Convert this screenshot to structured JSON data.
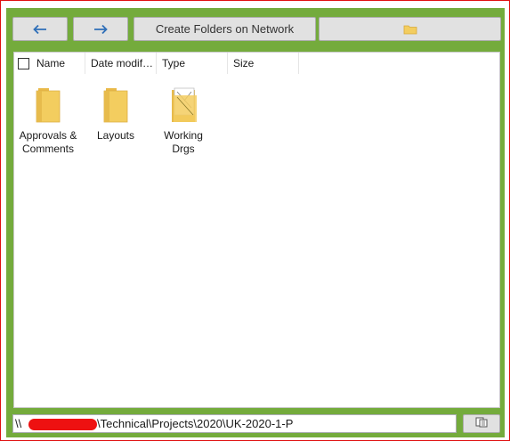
{
  "toolbar": {
    "back_icon": "arrow-left-icon",
    "forward_icon": "arrow-right-icon",
    "create_label": "Create Folders on Network",
    "folder_icon": "folder-icon"
  },
  "list": {
    "columns": [
      "Name",
      "Date modif…",
      "Type",
      "Size"
    ],
    "items": [
      {
        "label": "Approvals &\nComments",
        "icon": "folder-icon"
      },
      {
        "label": "Layouts",
        "icon": "folder-icon"
      },
      {
        "label": "Working\nDrgs",
        "icon": "folder-with-drawing-icon"
      }
    ]
  },
  "path": {
    "prefix": "\\\\",
    "value": "\\Technical\\Projects\\2020\\UK-2020-1-P"
  },
  "colors": {
    "panel": "#74ab3c",
    "frame_border": "#e01010",
    "redaction": "#ee1111",
    "folder": "#f3cd5f"
  }
}
